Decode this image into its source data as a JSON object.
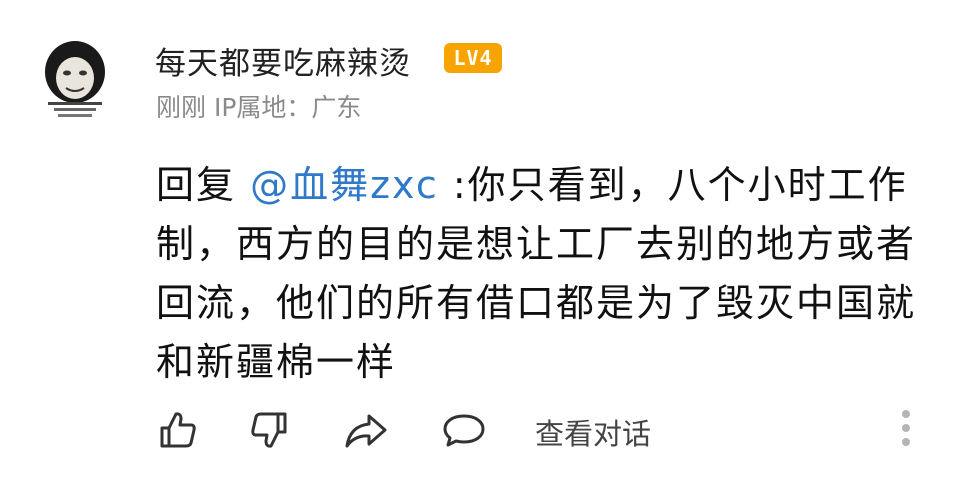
{
  "comment": {
    "username": "每天都要吃麻辣烫",
    "level_badge": "LV4",
    "meta": "刚刚 IP属地：广东",
    "reply_prefix": "回复 ",
    "mention": "@血舞zxc",
    "content": " :你只看到，八个小时工作制，西方的目的是想让工厂去别的地方或者回流，他们的所有借口都是为了毁灭中国就和新疆棉一样"
  },
  "actions": {
    "view_conversation": "查看对话"
  },
  "colors": {
    "mention": "#2f79c8",
    "badge": "#f7a400",
    "meta": "#8a8a8a",
    "icon": "#333333"
  }
}
